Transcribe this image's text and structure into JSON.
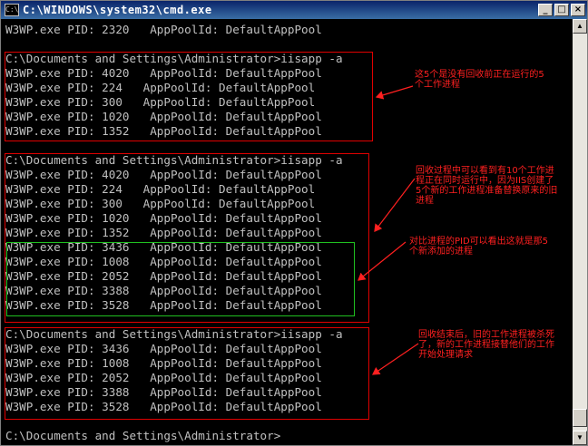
{
  "window": {
    "title": "C:\\WINDOWS\\system32\\cmd.exe",
    "app_icon_label": "C:\\",
    "controls": {
      "minimize": "_",
      "maximize": "□",
      "close": "×"
    },
    "scroll_up": "▲",
    "scroll_down": "▼"
  },
  "console": {
    "lines": [
      "W3WP.exe PID: 2320   AppPoolId: DefaultAppPool",
      "",
      "C:\\Documents and Settings\\Administrator>iisapp -a",
      "W3WP.exe PID: 4020   AppPoolId: DefaultAppPool",
      "W3WP.exe PID: 224   AppPoolId: DefaultAppPool",
      "W3WP.exe PID: 300   AppPoolId: DefaultAppPool",
      "W3WP.exe PID: 1020   AppPoolId: DefaultAppPool",
      "W3WP.exe PID: 1352   AppPoolId: DefaultAppPool",
      "",
      "C:\\Documents and Settings\\Administrator>iisapp -a",
      "W3WP.exe PID: 4020   AppPoolId: DefaultAppPool",
      "W3WP.exe PID: 224   AppPoolId: DefaultAppPool",
      "W3WP.exe PID: 300   AppPoolId: DefaultAppPool",
      "W3WP.exe PID: 1020   AppPoolId: DefaultAppPool",
      "W3WP.exe PID: 1352   AppPoolId: DefaultAppPool",
      "W3WP.exe PID: 3436   AppPoolId: DefaultAppPool",
      "W3WP.exe PID: 1008   AppPoolId: DefaultAppPool",
      "W3WP.exe PID: 2052   AppPoolId: DefaultAppPool",
      "W3WP.exe PID: 3388   AppPoolId: DefaultAppPool",
      "W3WP.exe PID: 3528   AppPoolId: DefaultAppPool",
      "",
      "C:\\Documents and Settings\\Administrator>iisapp -a",
      "W3WP.exe PID: 3436   AppPoolId: DefaultAppPool",
      "W3WP.exe PID: 1008   AppPoolId: DefaultAppPool",
      "W3WP.exe PID: 2052   AppPoolId: DefaultAppPool",
      "W3WP.exe PID: 3388   AppPoolId: DefaultAppPool",
      "W3WP.exe PID: 3528   AppPoolId: DefaultAppPool",
      "",
      "C:\\Documents and Settings\\Administrator>"
    ]
  },
  "annotations": {
    "note1": [
      "这5个是没有回收前正在运行的5",
      "个工作进程"
    ],
    "note2": [
      "回收过程中可以看到有10个工作进",
      "程正在同时运行中，因为IIS创建了",
      "5个新的工作进程准备替换原来的旧",
      "进程"
    ],
    "note3": [
      "对比进程的PID可以看出这就是那5",
      "个新添加的进程"
    ],
    "note4": [
      "回收结束后，旧的工作进程被杀死",
      "了，新的工作进程接替他们的工作",
      "开始处理请求"
    ]
  },
  "colors": {
    "console_bg": "#000000",
    "console_text": "#c0c0c0",
    "annotation": "#ff2020",
    "highlight_box": "#e00000",
    "new_process_box": "#20c020"
  }
}
